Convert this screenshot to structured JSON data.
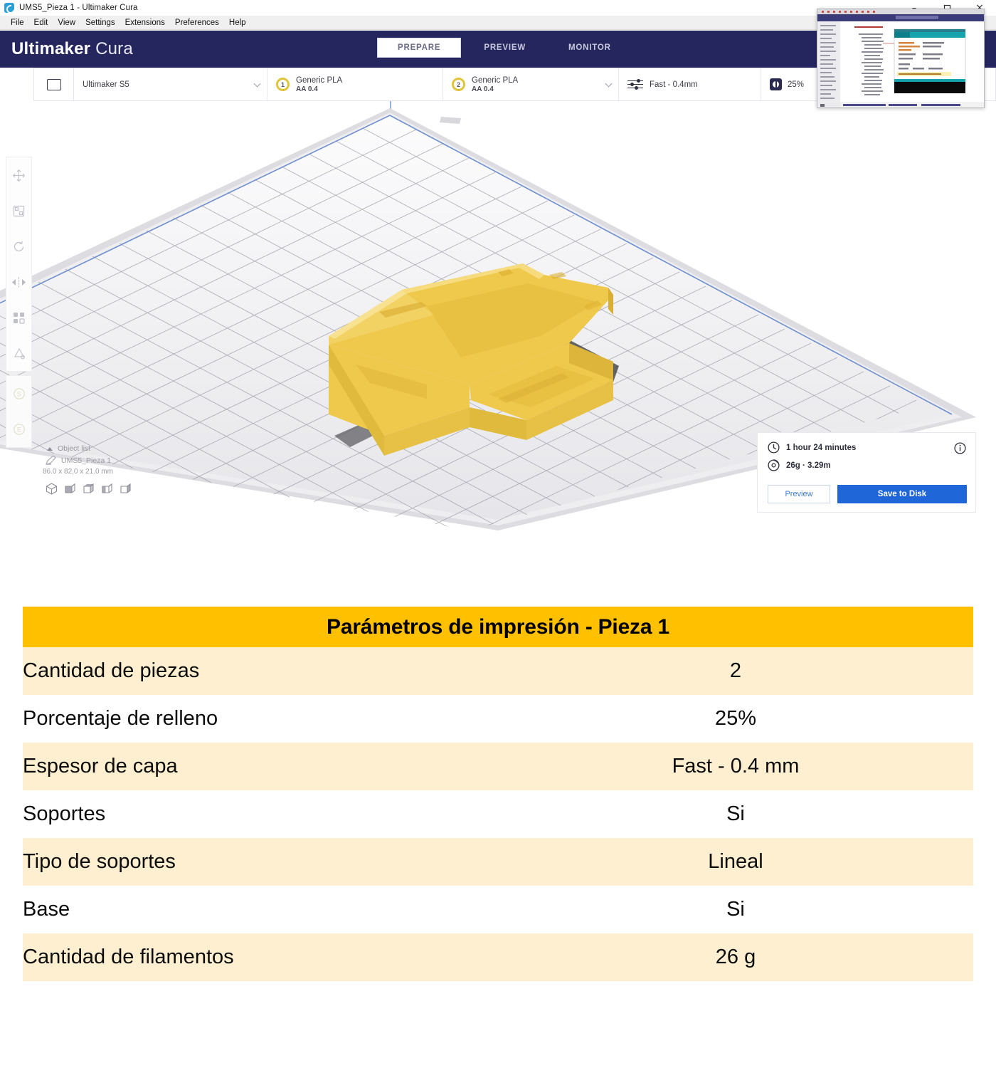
{
  "window": {
    "title": "UMS5_Pieza 1 - Ultimaker Cura",
    "app_icon": "cura-logo-icon",
    "controls": {
      "minimize": "–",
      "maximize": "❐",
      "close": "×"
    }
  },
  "menubar": {
    "items": [
      "File",
      "Edit",
      "View",
      "Settings",
      "Extensions",
      "Preferences",
      "Help"
    ]
  },
  "header": {
    "brand_bold": "Ultimaker",
    "brand_light": "Cura",
    "tabs": [
      {
        "label": "PREPARE",
        "active": true
      },
      {
        "label": "PREVIEW",
        "active": false
      },
      {
        "label": "MONITOR",
        "active": false
      }
    ]
  },
  "settings_bar": {
    "open_file_icon": "folder-open-icon",
    "printer": "Ultimaker S5",
    "extruder_1": {
      "number": "1",
      "material": "Generic PLA",
      "nozzle": "AA 0.4"
    },
    "extruder_2": {
      "number": "2",
      "material": "Generic PLA",
      "nozzle": "AA 0.4"
    },
    "profile": "Fast - 0.4mm",
    "profile_icon": "print-settings-sliders-icon",
    "infill": "25%",
    "infill_icon": "infill-density-icon"
  },
  "viewport": {
    "tools": [
      "move-tool-icon",
      "scale-tool-icon",
      "rotate-tool-icon",
      "mirror-tool-icon",
      "per-model-settings-icon",
      "support-blocker-icon"
    ],
    "tools_secondary": [
      "support-eraser-icon",
      "custom-supports-icon"
    ],
    "object_list": {
      "title": "Object list",
      "item_name": "UMS5_Pieza 1",
      "dimensions": "86.0 x 82.0 x 21.0 mm",
      "view_icons": [
        "view-3d-icon",
        "view-front-icon",
        "view-top-icon",
        "view-left-icon",
        "view-right-icon"
      ]
    },
    "model_color": "#EFC94C",
    "support_color": "#4a4a4a",
    "buildplate_color": "#e9e9ec"
  },
  "print_info": {
    "time_icon": "clock-icon",
    "time": "1 hour 24 minutes",
    "material_icon": "filament-spool-icon",
    "material": "26g · 3.29m",
    "info_icon": "info-circle-icon",
    "preview_button": "Preview",
    "save_button": "Save to Disk",
    "accent_color": "#1f67d9"
  },
  "overlay_window": {
    "name": "background-ide-window"
  },
  "table": {
    "title": "Parámetros de impresión - Pieza 1",
    "header_color": "#FFC000",
    "alt_row_color": "#FDEFD0",
    "rows": [
      {
        "label": "Cantidad de piezas",
        "value": "2"
      },
      {
        "label": "Porcentaje de relleno",
        "value": "25%"
      },
      {
        "label": "Espesor de capa",
        "value": "Fast - 0.4 mm"
      },
      {
        "label": "Soportes",
        "value": "Si"
      },
      {
        "label": "Tipo de soportes",
        "value": "Lineal"
      },
      {
        "label": "Base",
        "value": "Si"
      },
      {
        "label": "Cantidad de filamentos",
        "value": "26 g"
      }
    ]
  }
}
